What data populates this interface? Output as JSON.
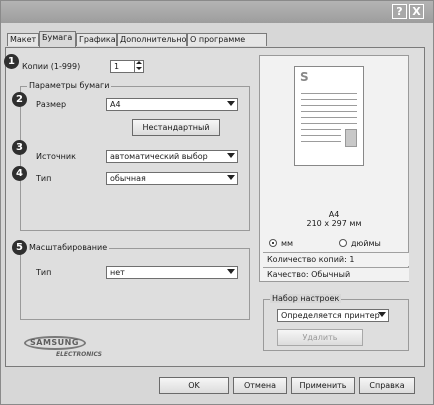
{
  "titlebar": {
    "help_label": "?",
    "close_label": "X"
  },
  "tabs": [
    {
      "label": "Макет"
    },
    {
      "label": "Бумага"
    },
    {
      "label": "Графика"
    },
    {
      "label": "Дополнительно"
    },
    {
      "label": "О программе"
    }
  ],
  "badges": [
    "1",
    "2",
    "3",
    "4",
    "5"
  ],
  "copies": {
    "label": "Копии (1-999)",
    "value": "1"
  },
  "paper_params": {
    "legend": "Параметры бумаги",
    "size_label": "Размер",
    "size_value": "A4",
    "custom_button": "Нестандартный",
    "source_label": "Источник",
    "source_value": "автоматический выбор",
    "type_label": "Тип",
    "type_value": "обычная"
  },
  "scaling": {
    "legend": "Масштабирование",
    "type_label": "Тип",
    "type_value": "нет"
  },
  "preview": {
    "paper_letter": "S",
    "paper_name": "A4",
    "paper_dims": "210 x 297 мм",
    "unit_mm": "мм",
    "unit_inch": "дюймы",
    "unit_selected": "мм",
    "copies_info": "Количество копий: 1",
    "quality_info": "Качество: Обычный"
  },
  "presets": {
    "legend": "Набор настроек",
    "value": "Определяется принтер",
    "delete_button": "Удалить"
  },
  "logo": {
    "brand": "SAMSUNG",
    "sub": "ELECTRONICS"
  },
  "footer": {
    "ok": "OK",
    "cancel": "Отмена",
    "apply": "Применить",
    "help": "Справка"
  }
}
